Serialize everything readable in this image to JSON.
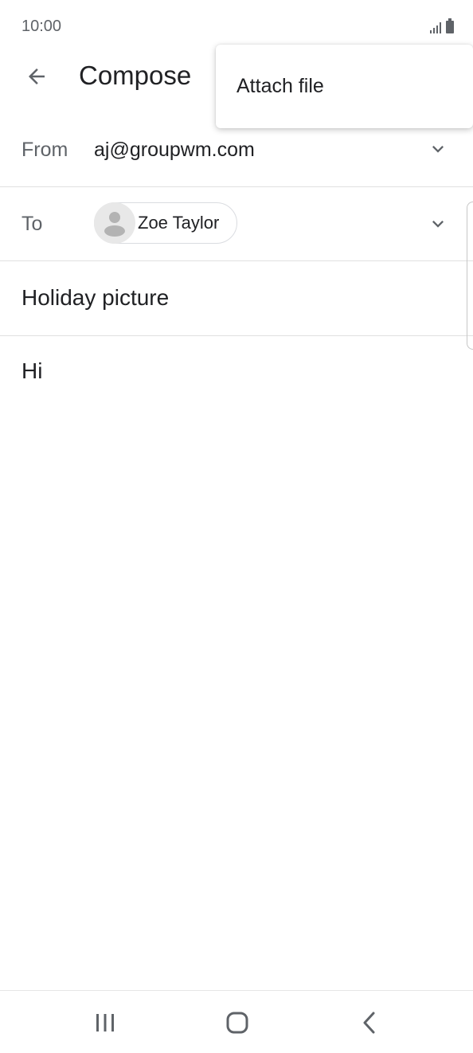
{
  "status_bar": {
    "time": "10:00",
    "icons": [
      "signal-icon",
      "battery-icon"
    ]
  },
  "app_bar": {
    "title": "Compose",
    "back_icon": "arrow-left-icon"
  },
  "overflow_menu": {
    "items": [
      {
        "label": "Attach file"
      }
    ]
  },
  "from": {
    "label": "From",
    "value": "aj@groupwm.com",
    "icon": "chevron-down-icon"
  },
  "to": {
    "label": "To",
    "recipients": [
      {
        "name": "Zoe Taylor",
        "avatar_icon": "person-icon"
      }
    ],
    "icon": "chevron-down-icon"
  },
  "subject": {
    "value": "Holiday picture"
  },
  "body": {
    "value": "Hi"
  },
  "nav_bar": {
    "buttons": [
      "recent-apps-icon",
      "home-icon",
      "back-icon"
    ]
  },
  "colors": {
    "text_primary": "#202124",
    "text_secondary": "#5f6368",
    "divider": "#e0e0e0",
    "icon_gray": "#5f6368"
  }
}
